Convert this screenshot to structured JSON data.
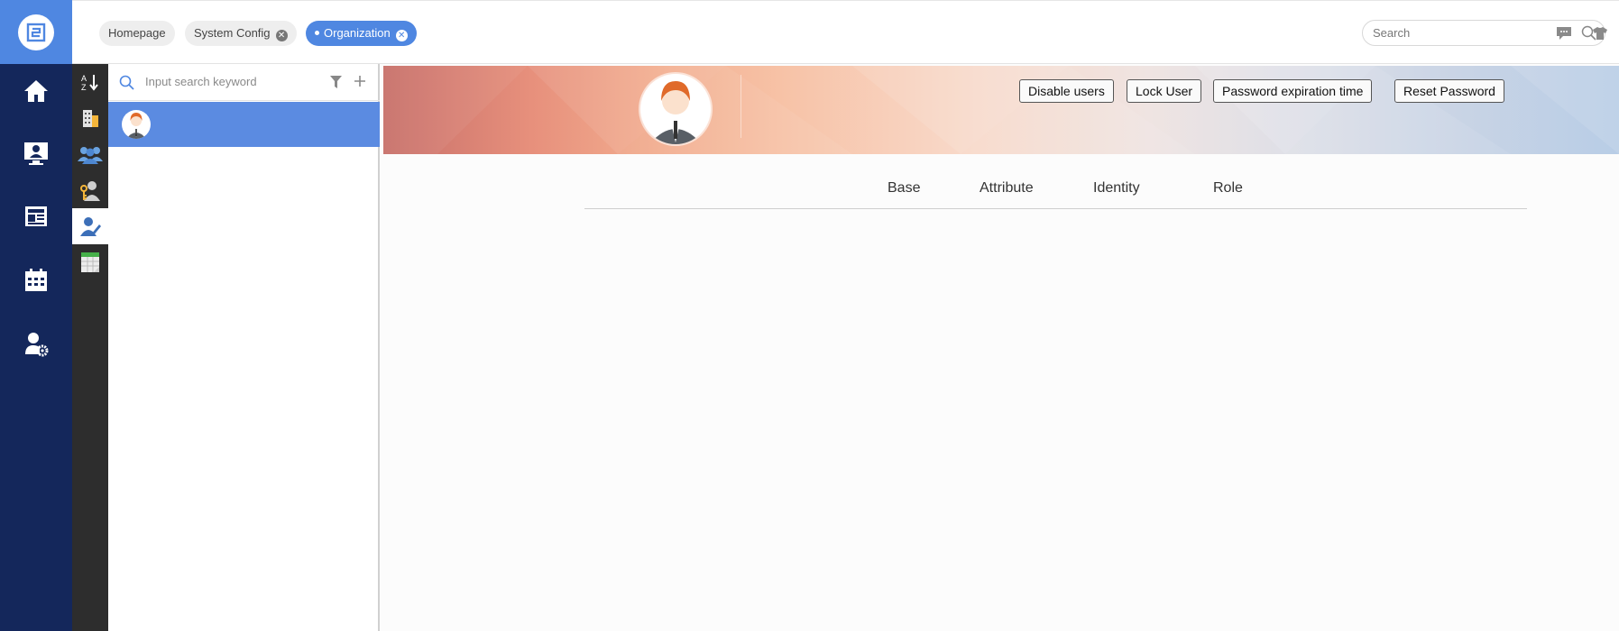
{
  "tabs": [
    {
      "label": "Homepage",
      "closable": false,
      "active": false
    },
    {
      "label": "System Config",
      "closable": true,
      "active": false
    },
    {
      "label": "Organization",
      "closable": true,
      "active": true
    }
  ],
  "search": {
    "placeholder": "Search"
  },
  "tree": {
    "search_placeholder": "Input search keyword"
  },
  "actions": {
    "disable_users": "Disable users",
    "lock_user": "Lock User",
    "password_expiration": "Password expiration time",
    "reset_password": "Reset Password"
  },
  "detail_tabs": [
    "Base",
    "Attribute",
    "Identity",
    "Role"
  ],
  "nav_icons": [
    "logo-icon",
    "home-icon",
    "monitor-user-icon",
    "news-icon",
    "calendar-icon",
    "user-settings-icon"
  ],
  "tool_icons": [
    "sort-icon",
    "building-icon",
    "group-icon",
    "key-user-icon",
    "user-edit-icon",
    "spreadsheet-icon"
  ],
  "colors": {
    "nav_bg": "#14275b",
    "accent": "#4f87e1",
    "tool_bg": "#2d2d2d",
    "selected_row": "#5b8be1"
  }
}
